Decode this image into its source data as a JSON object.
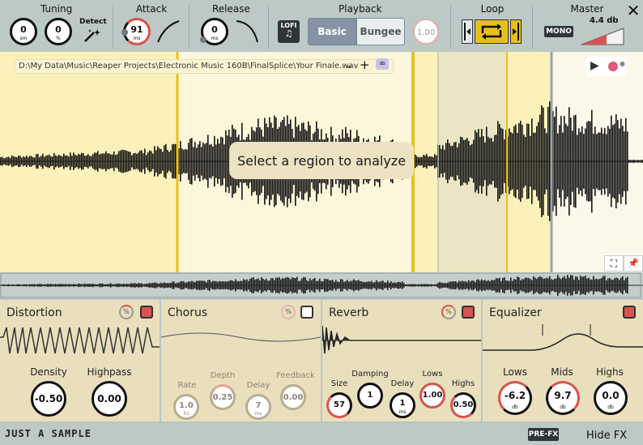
{
  "toolbar": {
    "tuning": {
      "title": "Tuning",
      "knob1": {
        "value": "0",
        "unit": "sm"
      },
      "knob2": {
        "value": "0",
        "unit": "%"
      },
      "detect_label": "Detect"
    },
    "attack": {
      "title": "Attack",
      "value": "91",
      "unit": "ms"
    },
    "release": {
      "title": "Release",
      "value": "0",
      "unit": "ms"
    },
    "playback": {
      "title": "Playback",
      "lofi_label": "LOFI",
      "modes": [
        "Basic",
        "Bungee"
      ],
      "selected_mode": "Basic",
      "rate_value": "1.00"
    },
    "loop": {
      "title": "Loop"
    },
    "master": {
      "title": "Master",
      "mono_label": "MONO",
      "gain": "4.4 db"
    }
  },
  "waveform": {
    "file_path": "D:\\My Data\\Music\\Reaper Projects\\Electronic Music 160B\\FinalSplice\\Your Finale.wav",
    "hint": "Select a region to analyze"
  },
  "fx": {
    "distortion": {
      "title": "Distortion",
      "enabled": true,
      "params": [
        {
          "label": "Density",
          "value": "-0.50"
        },
        {
          "label": "Highpass",
          "value": "0.00"
        }
      ]
    },
    "chorus": {
      "title": "Chorus",
      "enabled": false,
      "params": [
        {
          "label": "Rate",
          "value": "1.0",
          "unit": "hz"
        },
        {
          "label": "Depth",
          "value": "0.25"
        },
        {
          "label": "Delay",
          "value": "7",
          "unit": "ms"
        },
        {
          "label": "Feedback",
          "value": "0.00"
        }
      ]
    },
    "reverb": {
      "title": "Reverb",
      "enabled": true,
      "params": [
        {
          "label": "Size",
          "value": "57"
        },
        {
          "label": "Damping",
          "value": "1"
        },
        {
          "label": "Delay",
          "value": "1",
          "unit": "ms"
        },
        {
          "label": "Lows",
          "value": "1.00"
        },
        {
          "label": "Highs",
          "value": "0.50"
        }
      ]
    },
    "equalizer": {
      "title": "Equalizer",
      "enabled": true,
      "params": [
        {
          "label": "Lows",
          "value": "-6.2",
          "unit": "db"
        },
        {
          "label": "Mids",
          "value": "9.7",
          "unit": "db"
        },
        {
          "label": "Highs",
          "value": "0.0",
          "unit": "db"
        }
      ]
    }
  },
  "footer": {
    "brand": "JUST A SAMPLE",
    "prefx_label": "PRE-FX",
    "hide_fx_label": "Hide FX"
  },
  "colors": {
    "accent_red": "#d9534f",
    "region_yellow": "#fdf0b5",
    "loop_yellow": "#e8c01c",
    "panel": "#e9dfbd"
  }
}
